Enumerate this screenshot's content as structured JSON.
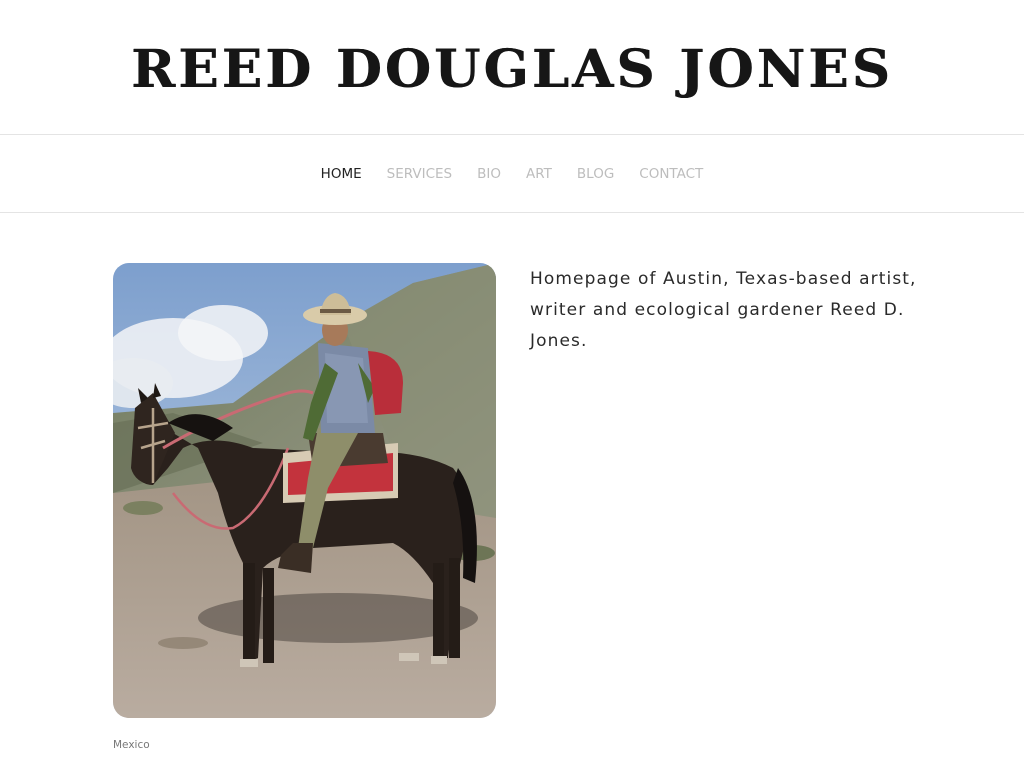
{
  "site": {
    "title": "Reed Douglas Jones"
  },
  "nav": {
    "items": [
      {
        "label": "HOME",
        "active": true
      },
      {
        "label": "SERVICES",
        "active": false
      },
      {
        "label": "BIO",
        "active": false
      },
      {
        "label": "ART",
        "active": false
      },
      {
        "label": "BLOG",
        "active": false
      },
      {
        "label": "CONTACT",
        "active": false
      }
    ]
  },
  "main": {
    "photo_caption": "Mexico",
    "intro": "Homepage of Austin, Texas-based artist, writer and ecological gardener Reed D. Jones."
  },
  "colors": {
    "nav_active": "#222222",
    "nav_inactive": "#bdbdbd",
    "divider": "#e4e4e4"
  }
}
